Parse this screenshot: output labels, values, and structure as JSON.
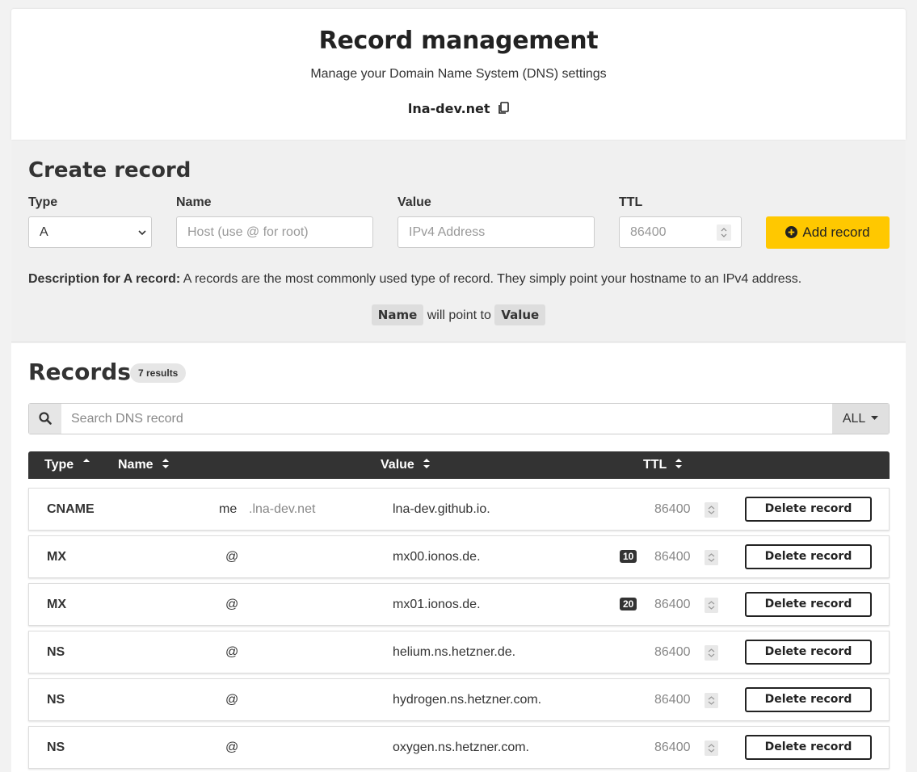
{
  "header": {
    "title": "Record management",
    "subtitle": "Manage your Domain Name System (DNS) settings",
    "domain": "lna-dev.net"
  },
  "create": {
    "title": "Create record",
    "type_label": "Type",
    "type_value": "A",
    "name_label": "Name",
    "name_placeholder": "Host (use @ for root)",
    "value_label": "Value",
    "value_placeholder": "IPv4 Address",
    "ttl_label": "TTL",
    "ttl_value": "86400",
    "add_label": "Add record",
    "description_label": "Description for A record:",
    "description_text": "A records are the most commonly used type of record. They simply point your hostname to an IPv4 address.",
    "pointer_name": "Name",
    "pointer_mid": "will point to",
    "pointer_value": "Value"
  },
  "records": {
    "title": "Records",
    "count_badge": "7 results",
    "search_placeholder": "Search DNS record",
    "filter_label": "ALL",
    "columns": [
      "Type",
      "Name",
      "Value",
      "TTL"
    ],
    "delete_label": "Delete record",
    "rows": [
      {
        "type": "CNAME",
        "name": "me",
        "suffix": ".lna-dev.net",
        "value": "lna-dev.github.io.",
        "priority": "",
        "ttl": "86400"
      },
      {
        "type": "MX",
        "name": "@",
        "suffix": "",
        "value": "mx00.ionos.de.",
        "priority": "10",
        "ttl": "86400"
      },
      {
        "type": "MX",
        "name": "@",
        "suffix": "",
        "value": "mx01.ionos.de.",
        "priority": "20",
        "ttl": "86400"
      },
      {
        "type": "NS",
        "name": "@",
        "suffix": "",
        "value": "helium.ns.hetzner.de.",
        "priority": "",
        "ttl": "86400"
      },
      {
        "type": "NS",
        "name": "@",
        "suffix": "",
        "value": "hydrogen.ns.hetzner.com.",
        "priority": "",
        "ttl": "86400"
      },
      {
        "type": "NS",
        "name": "@",
        "suffix": "",
        "value": "oxygen.ns.hetzner.com.",
        "priority": "",
        "ttl": "86400"
      }
    ]
  },
  "colors": {
    "accent": "#ffc800",
    "table_header": "#333333",
    "panel_bg": "#f0f0f0"
  }
}
